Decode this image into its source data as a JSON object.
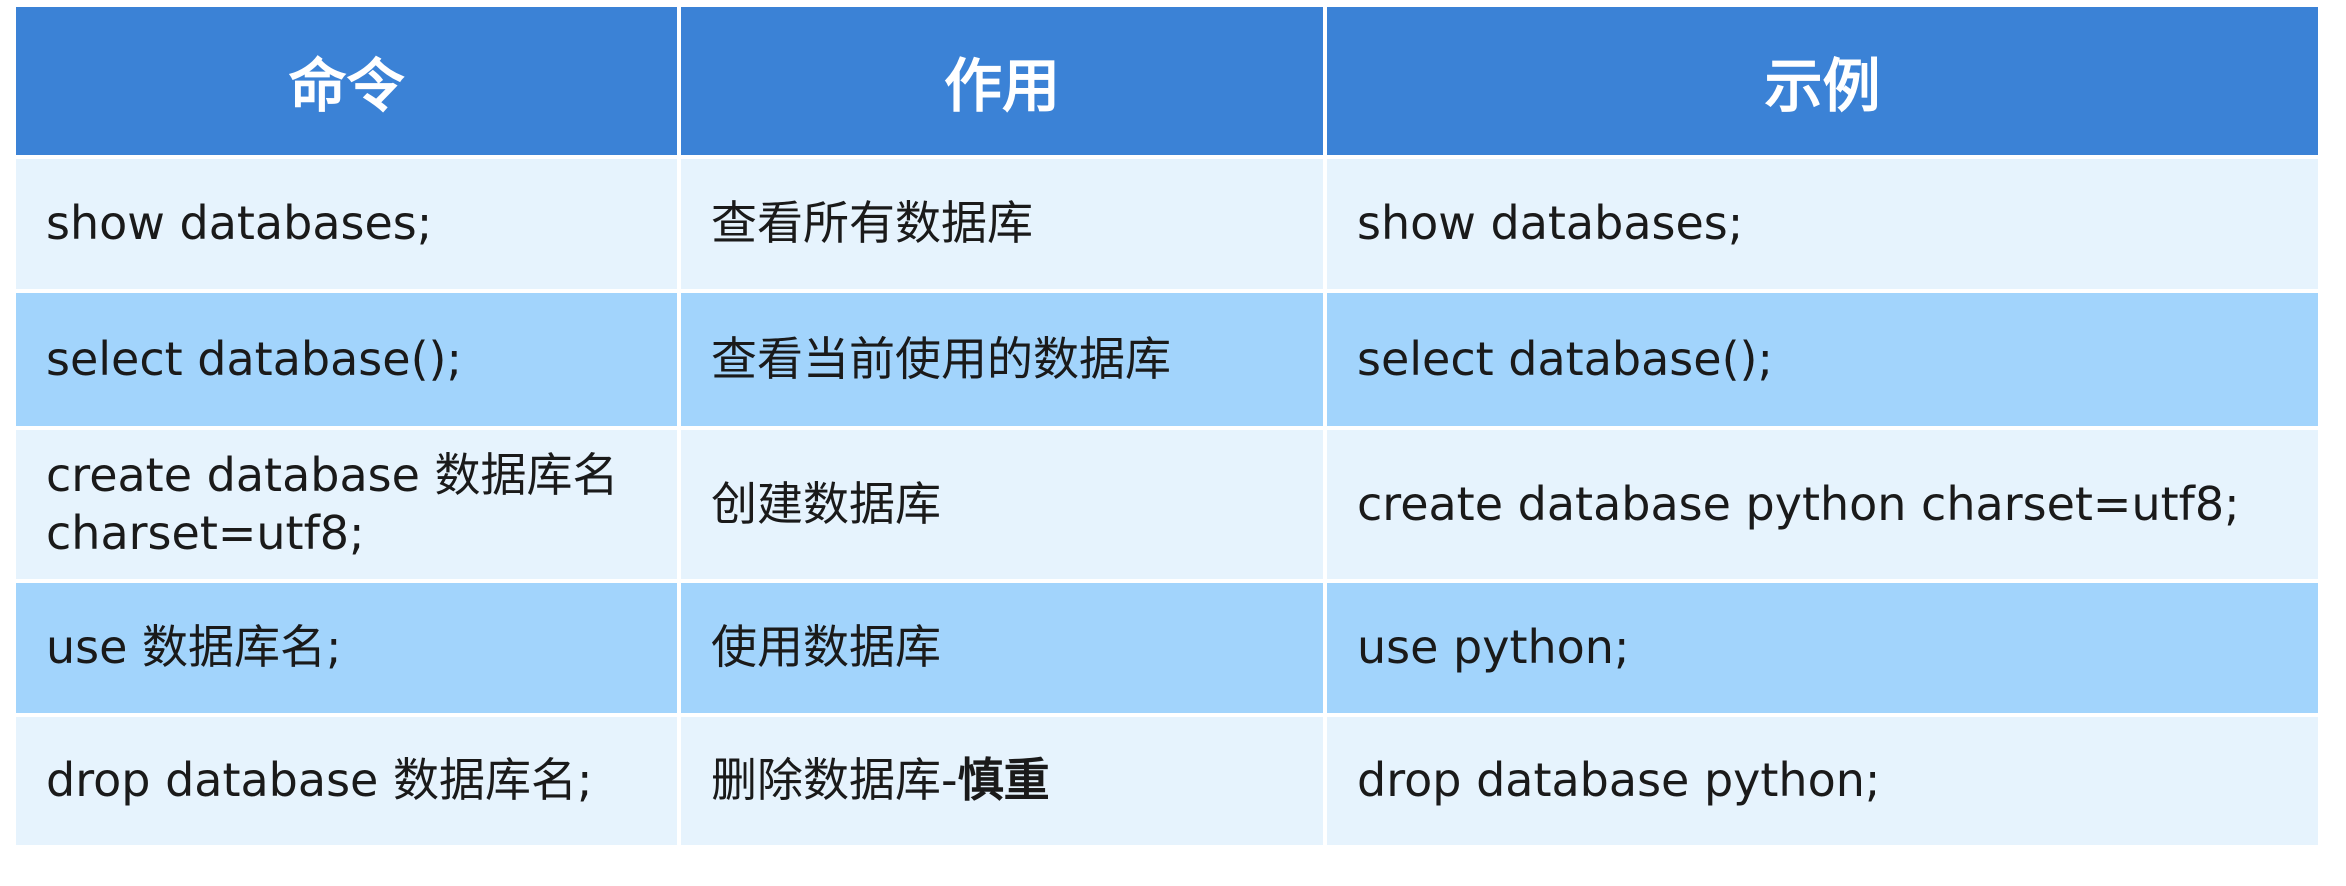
{
  "table": {
    "headers": [
      "命令",
      "作用",
      "示例"
    ],
    "rows": [
      {
        "command": "show databases;",
        "purpose": "查看所有数据库",
        "purpose_bold": "",
        "example": "show databases;"
      },
      {
        "command": "select database();",
        "purpose": "查看当前使用的数据库",
        "purpose_bold": "",
        "example": "select database();"
      },
      {
        "command": "create database 数据库名 charset=utf8;",
        "purpose": "创建数据库",
        "purpose_bold": "",
        "example": "create database python charset=utf8;"
      },
      {
        "command": "use 数据库名;",
        "purpose": "使用数据库",
        "purpose_bold": "",
        "example": "use python;"
      },
      {
        "command": "drop database 数据库名;",
        "purpose": "删除数据库-",
        "purpose_bold": "慎重",
        "example": "drop database python;"
      }
    ]
  },
  "colors": {
    "header_bg": "#3b82d6",
    "header_text": "#ffffff",
    "row_light": "#e6f3fd",
    "row_dark": "#a2d4fc",
    "body_text": "#1a1a1a"
  }
}
